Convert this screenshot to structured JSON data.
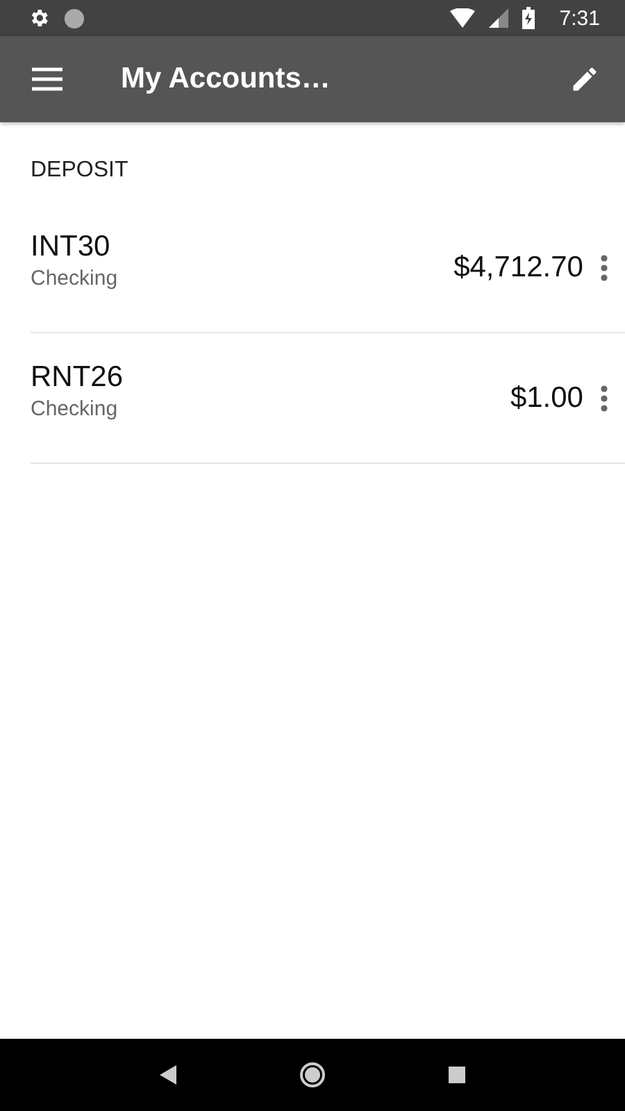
{
  "status_bar": {
    "time": "7:31"
  },
  "app_bar": {
    "title": "My Accounts…"
  },
  "section": {
    "title": "DEPOSIT"
  },
  "accounts": [
    {
      "name": "INT30",
      "type": "Checking",
      "balance": "$4,712.70"
    },
    {
      "name": "RNT26",
      "type": "Checking",
      "balance": "$1.00"
    }
  ]
}
